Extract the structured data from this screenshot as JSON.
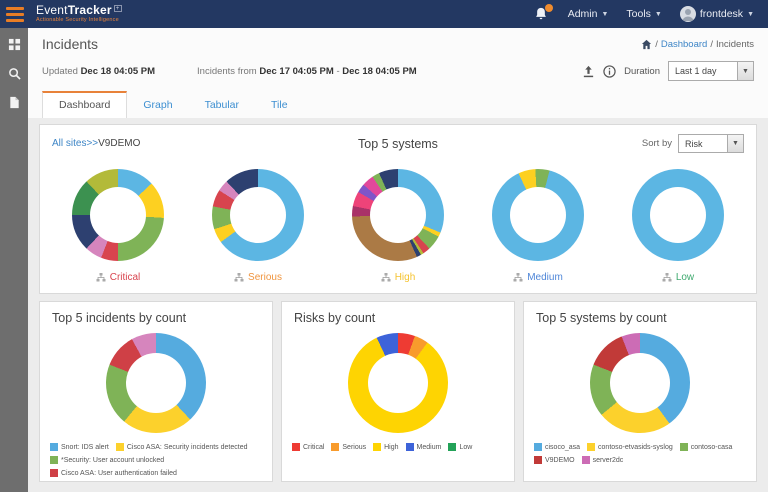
{
  "navbar": {
    "brand_event": "Event",
    "brand_tracker": "Tracker",
    "tagline": "Actionable Security Intelligence",
    "admin_label": "Admin",
    "tools_label": "Tools",
    "user_label": "frontdesk"
  },
  "header": {
    "title": "Incidents",
    "breadcrumb_sep1": "/",
    "breadcrumb_dashboard": "Dashboard",
    "breadcrumb_sep2": "/",
    "breadcrumb_current": "Incidents",
    "updated_label": "Updated",
    "updated_value": "Dec 18 04:05 PM",
    "range_label": "Incidents from",
    "range_start": "Dec 17 04:05 PM",
    "range_sep": "-",
    "range_end": "Dec 18 04:05 PM",
    "duration_label": "Duration",
    "duration_value": "Last 1 day"
  },
  "tabs": {
    "dashboard": "Dashboard",
    "graph": "Graph",
    "tabular": "Tabular",
    "tile": "Tile"
  },
  "top_systems": {
    "sites_link": "All sites>>",
    "site_name": "V9DEMO",
    "title": "Top 5 systems",
    "sort_by_label": "Sort by",
    "sort_value": "Risk"
  },
  "chart_data": [
    {
      "type": "donut",
      "label": "Critical",
      "label_color": "#d8444e",
      "from": 0,
      "segments": [
        {
          "color": "#5cb6e3",
          "value": 13
        },
        {
          "color": "#fdd021",
          "value": 13
        },
        {
          "color": "#7fb357",
          "value": 24
        },
        {
          "color": "#d8444e",
          "value": 6
        },
        {
          "color": "#d685bd",
          "value": 6
        },
        {
          "color": "#2d4070",
          "value": 13
        },
        {
          "color": "#3c9150",
          "value": 13
        },
        {
          "color": "#b3ba39",
          "value": 12
        }
      ]
    },
    {
      "type": "donut",
      "label": "Serious",
      "label_color": "#f0953f",
      "from": 0,
      "segments": [
        {
          "color": "#5cb6e3",
          "value": 65
        },
        {
          "color": "#fdd021",
          "value": 5
        },
        {
          "color": "#7fb357",
          "value": 8
        },
        {
          "color": "#d8444e",
          "value": 6
        },
        {
          "color": "#d685bd",
          "value": 4
        },
        {
          "color": "#2d4070",
          "value": 12
        }
      ]
    },
    {
      "type": "donut",
      "label": "High",
      "label_color": "#f5c32f",
      "from": 0,
      "segments": [
        {
          "color": "#5cb6e3",
          "value": 30
        },
        {
          "color": "#fdd021",
          "value": 1.5
        },
        {
          "color": "#7fb357",
          "value": 5
        },
        {
          "color": "#d8444e",
          "value": 2.5
        },
        {
          "color": "#b3ba39",
          "value": 1
        },
        {
          "color": "#2d4070",
          "value": 1.5
        },
        {
          "color": "#ab7a45",
          "value": 30
        },
        {
          "color": "#a93268",
          "value": 3.5
        },
        {
          "color": "#ee4379",
          "value": 5
        },
        {
          "color": "#8055c8",
          "value": 3
        },
        {
          "color": "#e2489b",
          "value": 4
        },
        {
          "color": "#7fb357",
          "value": 2.5
        },
        {
          "color": "#2d4070",
          "value": 6.5
        }
      ]
    },
    {
      "type": "donut",
      "label": "Medium",
      "label_color": "#4f86d8",
      "from": -25,
      "segments": [
        {
          "color": "#fdd021",
          "value": 6
        },
        {
          "color": "#7fb357",
          "value": 5
        },
        {
          "color": "#5cb6e3",
          "value": 89
        }
      ]
    },
    {
      "type": "donut",
      "label": "Low",
      "label_color": "#3faa6f",
      "from": 0,
      "segments": [
        {
          "color": "#5cb6e3",
          "value": 100
        }
      ]
    },
    {
      "type": "donut",
      "title": "Top 5 incidents by count",
      "from": 0,
      "segments": [
        {
          "label": "Snort: IDS alert",
          "color": "#55abdf",
          "value": 38
        },
        {
          "label": "Cisco ASA: Security incidents detected",
          "color": "#fcd12c",
          "value": 23
        },
        {
          "label": "*Security: User account unlocked",
          "color": "#7fb357",
          "value": 20
        },
        {
          "label": "Cisco ASA: User authentication failed",
          "color": "#cf4046",
          "value": 11
        },
        {
          "color": "#d685bd",
          "value": 8
        }
      ]
    },
    {
      "type": "donut",
      "title": "Risks by count",
      "from": 0,
      "segments": [
        {
          "label": "Critical",
          "color": "#ee3b33",
          "value": 5.5
        },
        {
          "label": "Serious",
          "color": "#f89b2c",
          "value": 4.5
        },
        {
          "label": "High",
          "color": "#fed402",
          "value": 83
        },
        {
          "label": "Medium",
          "color": "#3d63d9",
          "value": 7
        },
        {
          "label": "Low",
          "color": "#23a258",
          "value": 0
        }
      ]
    },
    {
      "type": "donut",
      "title": "Top 5 systems by count",
      "from": 0,
      "segments": [
        {
          "label": "cisoco_asa",
          "color": "#55abdf",
          "value": 40
        },
        {
          "label": "contoso-etvasids-syslog",
          "color": "#fcd12c",
          "value": 24
        },
        {
          "label": "contoso-casa",
          "color": "#7fb357",
          "value": 17
        },
        {
          "label": "V9DEMO",
          "color": "#c13a38",
          "value": 13
        },
        {
          "label": "server2dc",
          "color": "#cc6cb5",
          "value": 6
        }
      ]
    }
  ]
}
